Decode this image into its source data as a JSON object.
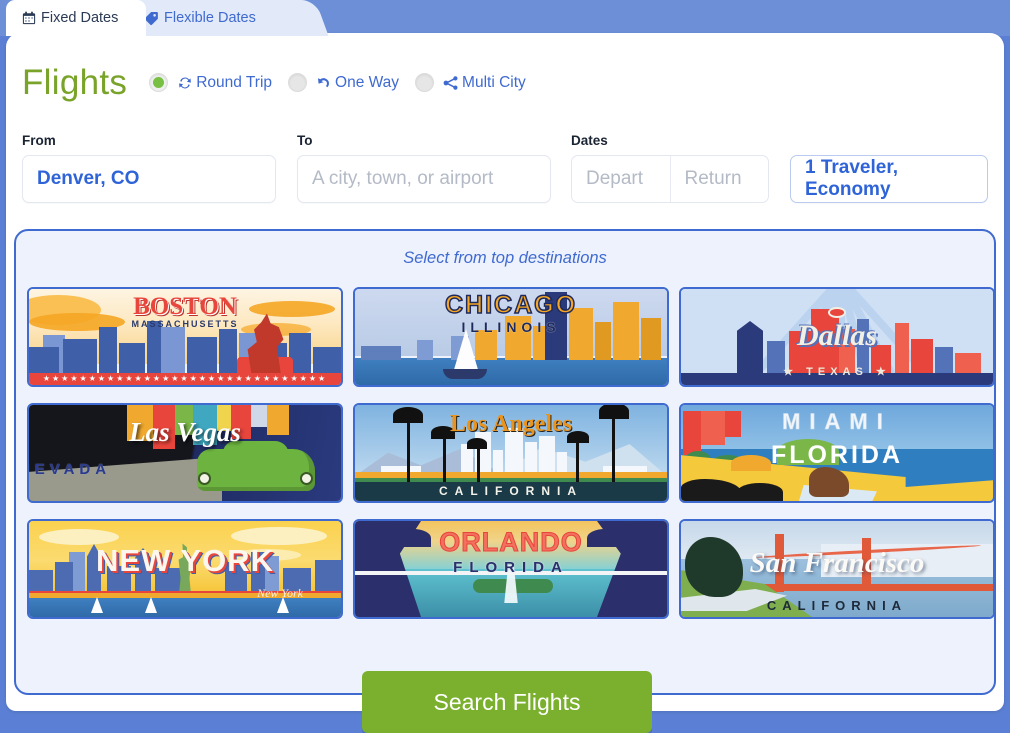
{
  "tabs": [
    {
      "id": "fixed-dates",
      "label": "Fixed Dates",
      "icon": "calendar-icon",
      "active": true
    },
    {
      "id": "flexible-dates",
      "label": "Flexible Dates",
      "icon": "tag-icon",
      "active": false
    }
  ],
  "header": {
    "title": "Flights",
    "title_color": "#7aa32a",
    "trip_types": [
      {
        "id": "round-trip",
        "label": "Round Trip",
        "icon": "refresh-icon",
        "selected": true
      },
      {
        "id": "one-way",
        "label": "One Way",
        "icon": "undo-arrow-icon",
        "selected": false
      },
      {
        "id": "multi-city",
        "label": "Multi City",
        "icon": "share-nodes-icon",
        "selected": false
      }
    ],
    "selected_color": "#78c043"
  },
  "form": {
    "from": {
      "label": "From",
      "value": "Denver, CO",
      "placeholder": "A city, town, or airport"
    },
    "to": {
      "label": "To",
      "value": "",
      "placeholder": "A city, town, or airport"
    },
    "dates": {
      "label": "Dates",
      "depart": {
        "value": "",
        "placeholder": "Depart"
      },
      "return": {
        "value": "",
        "placeholder": "Return"
      }
    },
    "travelers": {
      "value": "1 Traveler, Economy"
    }
  },
  "destinations": {
    "heading": "Select from top destinations",
    "cards": [
      {
        "id": "boston",
        "city": "BOSTON",
        "region": "MASSACHUSETTS"
      },
      {
        "id": "chicago",
        "city": "CHICAGO",
        "region": "ILLINOIS"
      },
      {
        "id": "dallas",
        "city": "Dallas",
        "region": "TEXAS"
      },
      {
        "id": "las-vegas",
        "city": "Las Vegas",
        "region": "NEVADA"
      },
      {
        "id": "los-angeles",
        "city": "Los Angeles",
        "region": "CALIFORNIA"
      },
      {
        "id": "miami",
        "city": "MIAMI",
        "region": "FLORIDA"
      },
      {
        "id": "new-york",
        "city": "NEW YORK",
        "region": "New York"
      },
      {
        "id": "orlando",
        "city": "ORLANDO",
        "region": "FLORIDA"
      },
      {
        "id": "san-francisco",
        "city": "San Francisco",
        "region": "CALIFORNIA"
      }
    ]
  },
  "actions": {
    "search_label": "Search Flights",
    "search_color": "#7ab02e"
  },
  "colors": {
    "page_background": "#5b7fd4",
    "accent_blue": "#3f6ad0",
    "panel_background": "#eef2fd"
  }
}
